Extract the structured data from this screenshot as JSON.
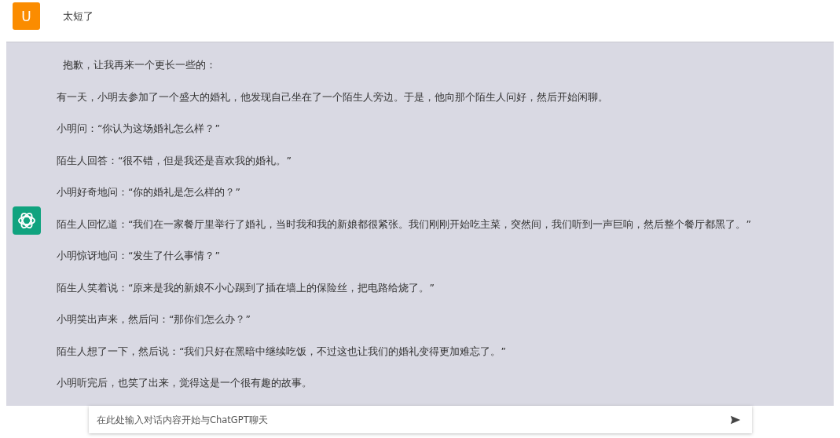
{
  "user_message": {
    "avatar": "U",
    "text": "太短了"
  },
  "assistant_message": {
    "paragraphs": [
      "抱歉，让我再来一个更长一些的：",
      "有一天，小明去参加了一个盛大的婚礼，他发现自己坐在了一个陌生人旁边。于是，他向那个陌生人问好，然后开始闲聊。",
      "小明问：“你认为这场婚礼怎么样？”",
      "陌生人回答：“很不错，但是我还是喜欢我的婚礼。”",
      "小明好奇地问：“你的婚礼是怎么样的？”",
      "陌生人回忆道：“我们在一家餐厅里举行了婚礼，当时我和我的新娘都很紧张。我们刚刚开始吃主菜，突然间，我们听到一声巨响，然后整个餐厅都黑了。”",
      "小明惊讶地问：“发生了什么事情？”",
      "陌生人笑着说：“原来是我的新娘不小心踢到了插在墙上的保险丝，把电路给烧了。”",
      "小明笑出声来，然后问：“那你们怎么办？”",
      "陌生人想了一下，然后说：“我们只好在黑暗中继续吃饭，不过这也让我们的婚礼变得更加难忘了。”",
      "小明听完后，也笑了出来，觉得这是一个很有趣的故事。"
    ]
  },
  "input": {
    "placeholder": "在此处输入对话内容开始与ChatGPT聊天"
  }
}
